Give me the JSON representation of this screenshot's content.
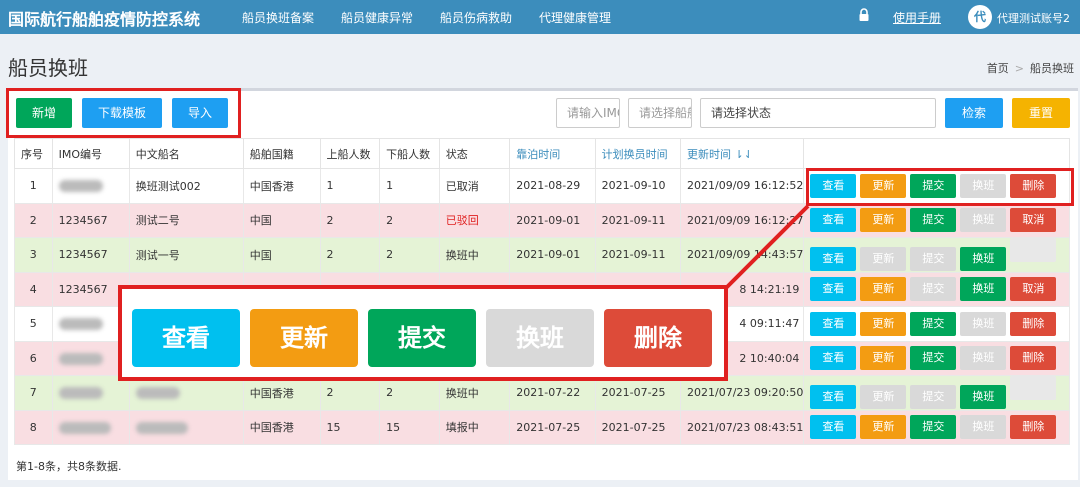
{
  "header": {
    "app_title": "国际航行船舶疫情防控系统",
    "nav": [
      "船员换班备案",
      "船员健康异常",
      "船员伤病救助",
      "代理健康管理"
    ],
    "manual": "使用手册",
    "avatar_text": "代",
    "user": "代理测试账号2"
  },
  "page": {
    "title": "船员换班",
    "breadcrumb": [
      "首页",
      "船员换班"
    ]
  },
  "toolbar": {
    "add": "新增",
    "download_template": "下载模板",
    "import": "导入",
    "input1_placeholder": "请输入IMO",
    "input2_placeholder": "请选择船舶",
    "status_placeholder": "请选择状态",
    "search": "检索",
    "reset": "重置"
  },
  "table": {
    "columns": [
      "序号",
      "IMO编号",
      "中文船名",
      "船舶国籍",
      "上船人数",
      "下船人数",
      "状态",
      "靠泊时间",
      "计划换员时间",
      "更新时间 ⇂⇃"
    ],
    "rows": [
      {
        "idx": "1",
        "imo": "",
        "name": "换班测试002",
        "nation": "中国香港",
        "on": "1",
        "off": "1",
        "status": "已取消",
        "berth": "2021-08-29",
        "plan": "2021-09-10",
        "updated": "2021/09/09 16:12:52",
        "actions": [
          "查看",
          "更新",
          "提交",
          "换班",
          "删除"
        ]
      },
      {
        "idx": "2",
        "imo": "1234567",
        "name": "测试二号",
        "nation": "中国",
        "on": "2",
        "off": "2",
        "status": "已驳回",
        "berth": "2021-09-01",
        "plan": "2021-09-11",
        "updated": "2021/09/09 16:12:27",
        "actions": [
          "查看",
          "更新",
          "提交",
          "换班",
          "取消"
        ]
      },
      {
        "idx": "3",
        "imo": "1234567",
        "name": "测试一号",
        "nation": "中国",
        "on": "2",
        "off": "2",
        "status": "换班中",
        "berth": "2021-09-01",
        "plan": "2021-09-11",
        "updated": "2021/09/09 14:43:57",
        "actions": [
          "查看",
          "更新",
          "提交",
          "换班",
          ""
        ]
      },
      {
        "idx": "4",
        "imo": "1234567",
        "name": "",
        "nation": "",
        "on": "",
        "off": "",
        "status": "",
        "berth": "",
        "plan": "",
        "updated": "8 14:21:19",
        "actions": [
          "查看",
          "更新",
          "提交",
          "换班",
          "取消"
        ]
      },
      {
        "idx": "5",
        "imo": "",
        "name": "",
        "nation": "",
        "on": "",
        "off": "",
        "status": "",
        "berth": "",
        "plan": "",
        "updated": "4 09:11:47",
        "actions": [
          "查看",
          "更新",
          "提交",
          "换班",
          "删除"
        ]
      },
      {
        "idx": "6",
        "imo": "",
        "name": "",
        "nation": "",
        "on": "",
        "off": "",
        "status": "",
        "berth": "",
        "plan": "",
        "updated": "2 10:40:04",
        "actions": [
          "查看",
          "更新",
          "提交",
          "换班",
          "删除"
        ]
      },
      {
        "idx": "7",
        "imo": "",
        "name": "",
        "nation": "中国香港",
        "on": "2",
        "off": "2",
        "status": "换班中",
        "berth": "2021-07-22",
        "plan": "2021-07-25",
        "updated": "2021/07/23 09:20:50",
        "actions": [
          "查看",
          "更新",
          "提交",
          "换班",
          ""
        ]
      },
      {
        "idx": "8",
        "imo": "",
        "name": "",
        "nation": "中国香港",
        "on": "15",
        "off": "15",
        "status": "填报中",
        "berth": "2021-07-25",
        "plan": "2021-07-25",
        "updated": "2021/07/23 08:43:51",
        "actions": [
          "查看",
          "更新",
          "提交",
          "换班",
          "删除"
        ]
      }
    ]
  },
  "footer": {
    "count": "第1-8条，共8条数据."
  },
  "zoom": {
    "buttons": [
      "查看",
      "更新",
      "提交",
      "换班",
      "删除"
    ]
  },
  "colors": {
    "nav": "#3c8dbc",
    "view": "#00c0ef",
    "update": "#f39c12",
    "submit": "#00a65a",
    "delete": "#dd4b39",
    "disabled": "#d9d9d9",
    "highlight": "#e02020"
  }
}
